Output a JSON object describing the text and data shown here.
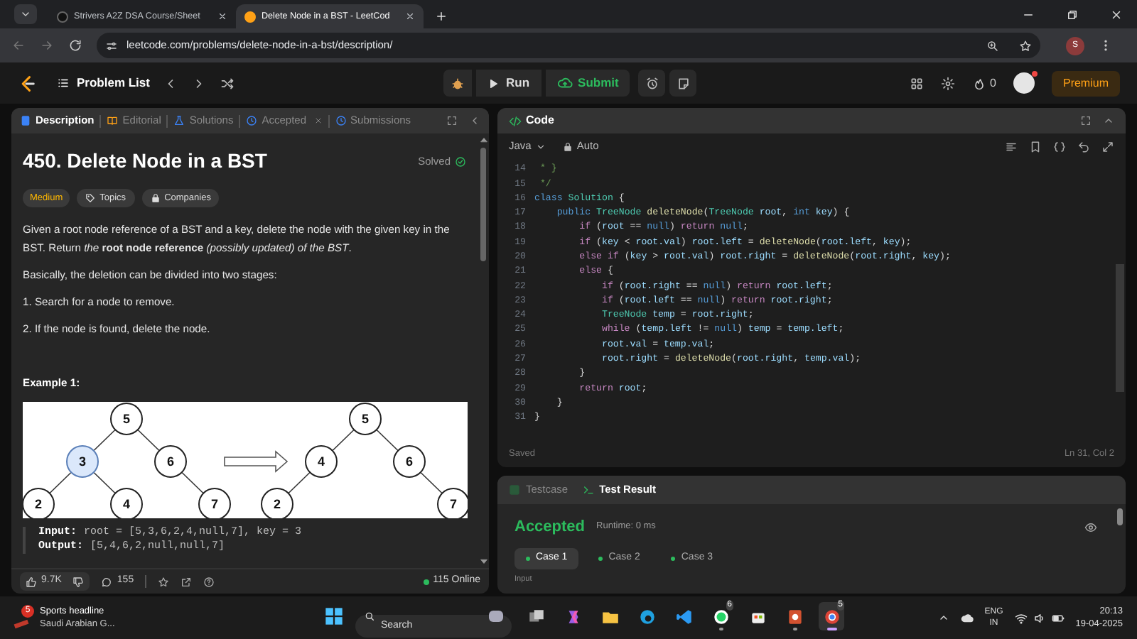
{
  "browser": {
    "tabs": [
      {
        "title": "Strivers A2Z DSA Course/Sheet",
        "selected": false
      },
      {
        "title": "Delete Node in a BST - LeetCod",
        "selected": true
      }
    ],
    "url": "leetcode.com/problems/delete-node-in-a-bst/description/",
    "profile_initial": "S"
  },
  "navbar": {
    "problem_list": "Problem List",
    "run": "Run",
    "submit": "Submit",
    "streak": "0",
    "premium": "Premium"
  },
  "description_panel": {
    "tabs": [
      {
        "label": "Description",
        "selected": true,
        "closable": false
      },
      {
        "label": "Editorial",
        "selected": false,
        "closable": false
      },
      {
        "label": "Solutions",
        "selected": false,
        "closable": false
      },
      {
        "label": "Accepted",
        "selected": false,
        "closable": true
      },
      {
        "label": "Submissions",
        "selected": false,
        "closable": false
      }
    ],
    "title": "450. Delete Node in a BST",
    "status": "Solved",
    "difficulty": "Medium",
    "tags": [
      "Topics",
      "Companies"
    ],
    "paragraphs": [
      "Given a root node reference of a BST and a key, delete the node with the given key in the BST. Return *the* **root node reference** *(possibly updated) of the BST*.",
      "Basically, the deletion can be divided into two stages:"
    ],
    "steps": [
      "1. Search for a node to remove.",
      "2. If the node is found, delete the node."
    ],
    "example_heading": "Example 1:",
    "diagram": {
      "before": {
        "label": "5",
        "highlighted": false,
        "left": {
          "label": "3",
          "highlighted": true,
          "left": {
            "label": "2",
            "highlighted": false
          },
          "right": {
            "label": "4",
            "highlighted": false
          }
        },
        "right": {
          "label": "6",
          "highlighted": false,
          "right": {
            "label": "7",
            "highlighted": false
          }
        }
      },
      "after": {
        "label": "5",
        "highlighted": false,
        "left": {
          "label": "4",
          "highlighted": false,
          "left": {
            "label": "2",
            "highlighted": false
          }
        },
        "right": {
          "label": "6",
          "highlighted": false,
          "right": {
            "label": "7",
            "highlighted": false
          }
        }
      }
    },
    "example_lines": [
      {
        "label": "Input:",
        "value": "root = [5,3,6,2,4,null,7], key = 3"
      },
      {
        "label": "Output:",
        "value": "[5,4,6,2,null,null,7]"
      }
    ],
    "likes": "9.7K",
    "comments": "155",
    "online": "115 Online"
  },
  "code_panel": {
    "title": "Code",
    "language": "Java",
    "mode": "Auto",
    "status": "Saved",
    "cursor": "Ln 31, Col 2",
    "lines": [
      {
        "number": "14",
        "tokens": [
          {
            "kind": "comment",
            "text": " * }"
          }
        ]
      },
      {
        "number": "15",
        "tokens": [
          {
            "kind": "comment",
            "text": " */"
          }
        ]
      },
      {
        "number": "16",
        "tokens": [
          {
            "kind": "keyword",
            "text": "class"
          },
          {
            "kind": "type",
            "text": " Solution"
          },
          {
            "kind": "plain",
            "text": " {"
          }
        ]
      },
      {
        "number": "17",
        "tokens": [
          {
            "kind": "keyword",
            "text": "    public"
          },
          {
            "kind": "type",
            "text": " TreeNode"
          },
          {
            "kind": "function",
            "text": " deleteNode"
          },
          {
            "kind": "plain",
            "text": "("
          },
          {
            "kind": "type",
            "text": "TreeNode"
          },
          {
            "kind": "variable",
            "text": " root"
          },
          {
            "kind": "plain",
            "text": ", "
          },
          {
            "kind": "keyword",
            "text": "int"
          },
          {
            "kind": "variable",
            "text": " key"
          },
          {
            "kind": "plain",
            "text": ") {"
          }
        ]
      },
      {
        "number": "18",
        "tokens": [
          {
            "kind": "control",
            "text": "        if"
          },
          {
            "kind": "plain",
            "text": " ("
          },
          {
            "kind": "variable",
            "text": "root"
          },
          {
            "kind": "plain",
            "text": " == "
          },
          {
            "kind": "keyword",
            "text": "null"
          },
          {
            "kind": "plain",
            "text": ") "
          },
          {
            "kind": "control",
            "text": "return"
          },
          {
            "kind": "keyword",
            "text": " null"
          },
          {
            "kind": "plain",
            "text": ";"
          }
        ]
      },
      {
        "number": "19",
        "tokens": [
          {
            "kind": "control",
            "text": "        if"
          },
          {
            "kind": "plain",
            "text": " ("
          },
          {
            "kind": "variable",
            "text": "key"
          },
          {
            "kind": "plain",
            "text": " < "
          },
          {
            "kind": "variable",
            "text": "root.val"
          },
          {
            "kind": "plain",
            "text": ") "
          },
          {
            "kind": "variable",
            "text": "root.left"
          },
          {
            "kind": "plain",
            "text": " = "
          },
          {
            "kind": "function",
            "text": "deleteNode"
          },
          {
            "kind": "plain",
            "text": "("
          },
          {
            "kind": "variable",
            "text": "root.left"
          },
          {
            "kind": "plain",
            "text": ", "
          },
          {
            "kind": "variable",
            "text": "key"
          },
          {
            "kind": "plain",
            "text": ");"
          }
        ]
      },
      {
        "number": "20",
        "tokens": [
          {
            "kind": "control",
            "text": "        else if"
          },
          {
            "kind": "plain",
            "text": " ("
          },
          {
            "kind": "variable",
            "text": "key"
          },
          {
            "kind": "plain",
            "text": " > "
          },
          {
            "kind": "variable",
            "text": "root.val"
          },
          {
            "kind": "plain",
            "text": ") "
          },
          {
            "kind": "variable",
            "text": "root.right"
          },
          {
            "kind": "plain",
            "text": " = "
          },
          {
            "kind": "function",
            "text": "deleteNode"
          },
          {
            "kind": "plain",
            "text": "("
          },
          {
            "kind": "variable",
            "text": "root.right"
          },
          {
            "kind": "plain",
            "text": ", "
          },
          {
            "kind": "variable",
            "text": "key"
          },
          {
            "kind": "plain",
            "text": ");"
          }
        ]
      },
      {
        "number": "21",
        "tokens": [
          {
            "kind": "control",
            "text": "        else"
          },
          {
            "kind": "plain",
            "text": " {"
          }
        ]
      },
      {
        "number": "22",
        "tokens": [
          {
            "kind": "control",
            "text": "            if"
          },
          {
            "kind": "plain",
            "text": " ("
          },
          {
            "kind": "variable",
            "text": "root.right"
          },
          {
            "kind": "plain",
            "text": " == "
          },
          {
            "kind": "keyword",
            "text": "null"
          },
          {
            "kind": "plain",
            "text": ") "
          },
          {
            "kind": "control",
            "text": "return"
          },
          {
            "kind": "variable",
            "text": " root.left"
          },
          {
            "kind": "plain",
            "text": ";"
          }
        ]
      },
      {
        "number": "23",
        "tokens": [
          {
            "kind": "control",
            "text": "            if"
          },
          {
            "kind": "plain",
            "text": " ("
          },
          {
            "kind": "variable",
            "text": "root.left"
          },
          {
            "kind": "plain",
            "text": " == "
          },
          {
            "kind": "keyword",
            "text": "null"
          },
          {
            "kind": "plain",
            "text": ") "
          },
          {
            "kind": "control",
            "text": "return"
          },
          {
            "kind": "variable",
            "text": " root.right"
          },
          {
            "kind": "plain",
            "text": ";"
          }
        ]
      },
      {
        "number": "24",
        "tokens": [
          {
            "kind": "type",
            "text": "            TreeNode"
          },
          {
            "kind": "variable",
            "text": " temp"
          },
          {
            "kind": "plain",
            "text": " = "
          },
          {
            "kind": "variable",
            "text": "root.right"
          },
          {
            "kind": "plain",
            "text": ";"
          }
        ]
      },
      {
        "number": "25",
        "tokens": [
          {
            "kind": "control",
            "text": "            while"
          },
          {
            "kind": "plain",
            "text": " ("
          },
          {
            "kind": "variable",
            "text": "temp.left"
          },
          {
            "kind": "plain",
            "text": " != "
          },
          {
            "kind": "keyword",
            "text": "null"
          },
          {
            "kind": "plain",
            "text": ") "
          },
          {
            "kind": "variable",
            "text": "temp"
          },
          {
            "kind": "plain",
            "text": " = "
          },
          {
            "kind": "variable",
            "text": "temp.left"
          },
          {
            "kind": "plain",
            "text": ";"
          }
        ]
      },
      {
        "number": "26",
        "tokens": [
          {
            "kind": "variable",
            "text": "            root.val"
          },
          {
            "kind": "plain",
            "text": " = "
          },
          {
            "kind": "variable",
            "text": "temp.val"
          },
          {
            "kind": "plain",
            "text": ";"
          }
        ]
      },
      {
        "number": "27",
        "tokens": [
          {
            "kind": "variable",
            "text": "            root.right"
          },
          {
            "kind": "plain",
            "text": " = "
          },
          {
            "kind": "function",
            "text": "deleteNode"
          },
          {
            "kind": "plain",
            "text": "("
          },
          {
            "kind": "variable",
            "text": "root.right"
          },
          {
            "kind": "plain",
            "text": ", "
          },
          {
            "kind": "variable",
            "text": "temp.val"
          },
          {
            "kind": "plain",
            "text": ");"
          }
        ]
      },
      {
        "number": "28",
        "tokens": [
          {
            "kind": "plain",
            "text": "        }"
          }
        ]
      },
      {
        "number": "29",
        "tokens": [
          {
            "kind": "control",
            "text": "        return"
          },
          {
            "kind": "variable",
            "text": " root"
          },
          {
            "kind": "plain",
            "text": ";"
          }
        ]
      },
      {
        "number": "30",
        "tokens": [
          {
            "kind": "plain",
            "text": "    }"
          }
        ]
      },
      {
        "number": "31",
        "tokens": [
          {
            "kind": "plain",
            "text": "}"
          }
        ]
      }
    ]
  },
  "test_panel": {
    "tabs": [
      {
        "label": "Testcase",
        "selected": false
      },
      {
        "label": "Test Result",
        "selected": true
      }
    ],
    "verdict": "Accepted",
    "runtime": "Runtime: 0 ms",
    "cases": [
      {
        "label": "Case 1",
        "selected": true
      },
      {
        "label": "Case 2",
        "selected": false
      },
      {
        "label": "Case 3",
        "selected": false
      }
    ],
    "section_label": "Input"
  },
  "taskbar": {
    "news": {
      "badge": "5",
      "title": "Sports headline",
      "subtitle": "Saudi Arabian G..."
    },
    "search_placeholder": "Search",
    "apps": [
      {
        "running": false,
        "selected": false
      },
      {
        "running": false,
        "selected": false
      },
      {
        "running": false,
        "selected": false
      },
      {
        "running": false,
        "selected": false
      },
      {
        "running": false,
        "selected": false
      },
      {
        "running": true,
        "selected": false,
        "badge": "6"
      },
      {
        "running": false,
        "selected": false
      },
      {
        "running": true,
        "selected": false
      },
      {
        "running": true,
        "selected": true,
        "badge": "5"
      }
    ],
    "language": "ENG",
    "region": "IN",
    "time": "20:13",
    "date": "19-04-2025"
  }
}
